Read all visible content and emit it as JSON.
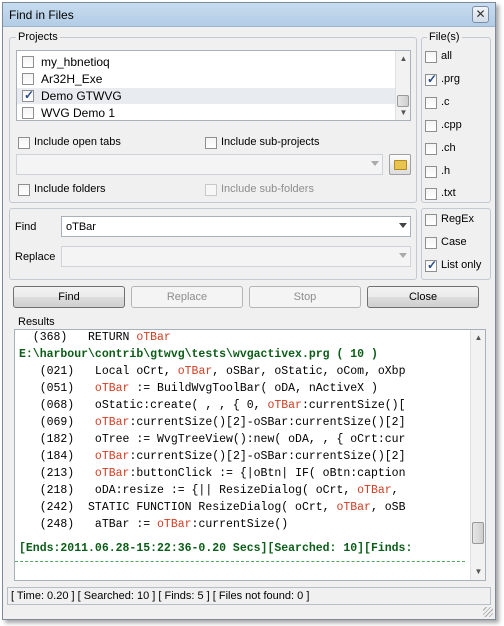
{
  "window": {
    "title": "Find in Files",
    "close_glyph": "✕"
  },
  "projects": {
    "label": "Projects",
    "items": [
      {
        "label": "my_hbnetioq",
        "checked": false
      },
      {
        "label": "Ar32H_Exe",
        "checked": false
      },
      {
        "label": "Demo GTWVG",
        "checked": true
      },
      {
        "label": "WVG Demo 1",
        "checked": false
      }
    ],
    "include_open_tabs": "Include open tabs",
    "include_sub_projects": "Include sub-projects",
    "include_folders": "Include folders",
    "include_sub_folders": "Include sub-folders"
  },
  "files": {
    "label": "File(s)",
    "items": [
      {
        "label": "all",
        "checked": false
      },
      {
        "label": ".prg",
        "checked": true
      },
      {
        "label": ".c",
        "checked": false
      },
      {
        "label": ".cpp",
        "checked": false
      },
      {
        "label": ".ch",
        "checked": false
      },
      {
        "label": ".h",
        "checked": false
      },
      {
        "label": ".txt",
        "checked": false
      }
    ]
  },
  "find": {
    "label": "Find",
    "value": "oTBar"
  },
  "replace": {
    "label": "Replace",
    "value": ""
  },
  "options": {
    "regex": "RegEx",
    "case": "Case",
    "list_only": "List only"
  },
  "buttons": {
    "find": "Find",
    "replace": "Replace",
    "stop": "Stop",
    "close": "Close"
  },
  "results": {
    "label": "Results",
    "lines": [
      {
        "pre": "  (368)   RETURN ",
        "hit": "oTBar",
        "post": ""
      },
      {
        "file": "E:\\harbour\\contrib\\gtwvg\\tests\\wvgactivex.prg ( 10 )"
      },
      {
        "pre": "   (021)   Local oCrt, ",
        "hit": "oTBar",
        "post": ", oSBar, oStatic, oCom, oXbp"
      },
      {
        "pre": "   (051)   ",
        "hit": "oTBar",
        "post": " := BuildWvgToolBar( oDA, nActiveX )"
      },
      {
        "pre": "   (068)   oStatic:create( , , { 0, ",
        "hit": "oTBar",
        "post": ":currentSize()["
      },
      {
        "pre": "   (069)   ",
        "hit": "oTBar",
        "post": ":currentSize()[2]-oSBar:currentSize()[2]"
      },
      {
        "pre": "   (182)   oTree := WvgTreeView():new( oDA, , { oCrt:cur"
      },
      {
        "pre": "   (184)   ",
        "hit": "oTBar",
        "post": ":currentSize()[2]-oSBar:currentSize()[2]"
      },
      {
        "pre": "   (213)   ",
        "hit": "oTBar",
        "post": ":buttonClick := {|oBtn| IF( oBtn:caption"
      },
      {
        "pre": "   (218)   oDA:resize := {|| ResizeDialog( oCrt, ",
        "hit": "oTBar",
        "post": ","
      },
      {
        "pre": "   (242)  STATIC FUNCTION ResizeDialog( oCrt, ",
        "hit": "oTBar",
        "post": ", oSB"
      },
      {
        "pre": "   (248)   aTBar := ",
        "hit": "oTBar",
        "post": ":currentSize()"
      }
    ],
    "summary": "[Ends:2011.06.28-15:22:36-0.20 Secs][Searched: 10][Finds:"
  },
  "status": "[ Time: 0.20 ] [ Searched: 10 ] [ Finds: 5 ] [ Files not found: 0 ]",
  "colors": {
    "hit": "#d23c22",
    "file_path": "#0a5c17"
  }
}
